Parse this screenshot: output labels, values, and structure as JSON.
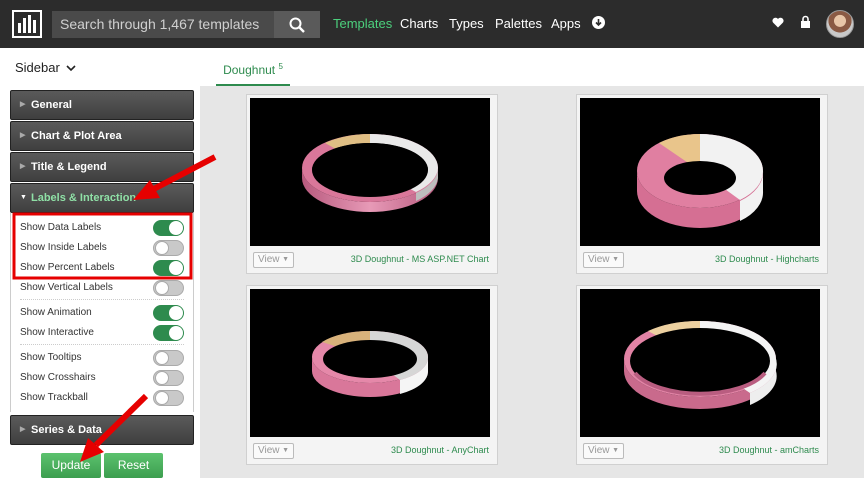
{
  "header": {
    "logo_icon": "bar-chart-logo-icon",
    "search_placeholder": "Search through 1,467 templates",
    "search_icon": "search-icon",
    "nav": [
      {
        "label": "Templates",
        "active": true
      },
      {
        "label": "Charts"
      },
      {
        "label": "Types"
      },
      {
        "label": "Palettes"
      },
      {
        "label": "Apps"
      }
    ],
    "icons": [
      "download-icon",
      "heart-icon",
      "lock-icon",
      "user-avatar"
    ]
  },
  "sidebar": {
    "toggle_label": "Sidebar",
    "sections": [
      {
        "label": "General"
      },
      {
        "label": "Chart & Plot Area"
      },
      {
        "label": "Title & Legend"
      },
      {
        "label": "Labels & Interaction",
        "open": true
      },
      {
        "label": "Series & Data"
      }
    ],
    "options": [
      {
        "label": "Show Data Labels",
        "on": true
      },
      {
        "label": "Show Inside Labels",
        "on": false
      },
      {
        "label": "Show Percent Labels",
        "on": true
      },
      {
        "label": "Show Vertical Labels",
        "on": false
      },
      {
        "label": "Show Animation",
        "on": true
      },
      {
        "label": "Show Interactive",
        "on": true
      },
      {
        "label": "Show Tooltips",
        "on": false
      },
      {
        "label": "Show Crosshairs",
        "on": false
      },
      {
        "label": "Show Trackball",
        "on": false
      }
    ],
    "update_label": "Update",
    "reset_label": "Reset"
  },
  "main": {
    "tab_label": "Doughnut",
    "tab_count": "5",
    "cards": [
      {
        "title": "3D Doughnut - MS ASP.NET Chart",
        "view_label": "View"
      },
      {
        "title": "3D Doughnut - Highcharts",
        "view_label": "View"
      },
      {
        "title": "3D Doughnut - AnyChart",
        "view_label": "View"
      },
      {
        "title": "3D Doughnut - amCharts",
        "view_label": "View"
      }
    ]
  },
  "colors": {
    "accent_green": "#2e8b4e",
    "nav_active": "#4cd07d",
    "annotation_red": "#e60000",
    "slice_pink": "#d9779a",
    "slice_tan": "#e6c48a",
    "slice_white": "#f2f2f2"
  }
}
